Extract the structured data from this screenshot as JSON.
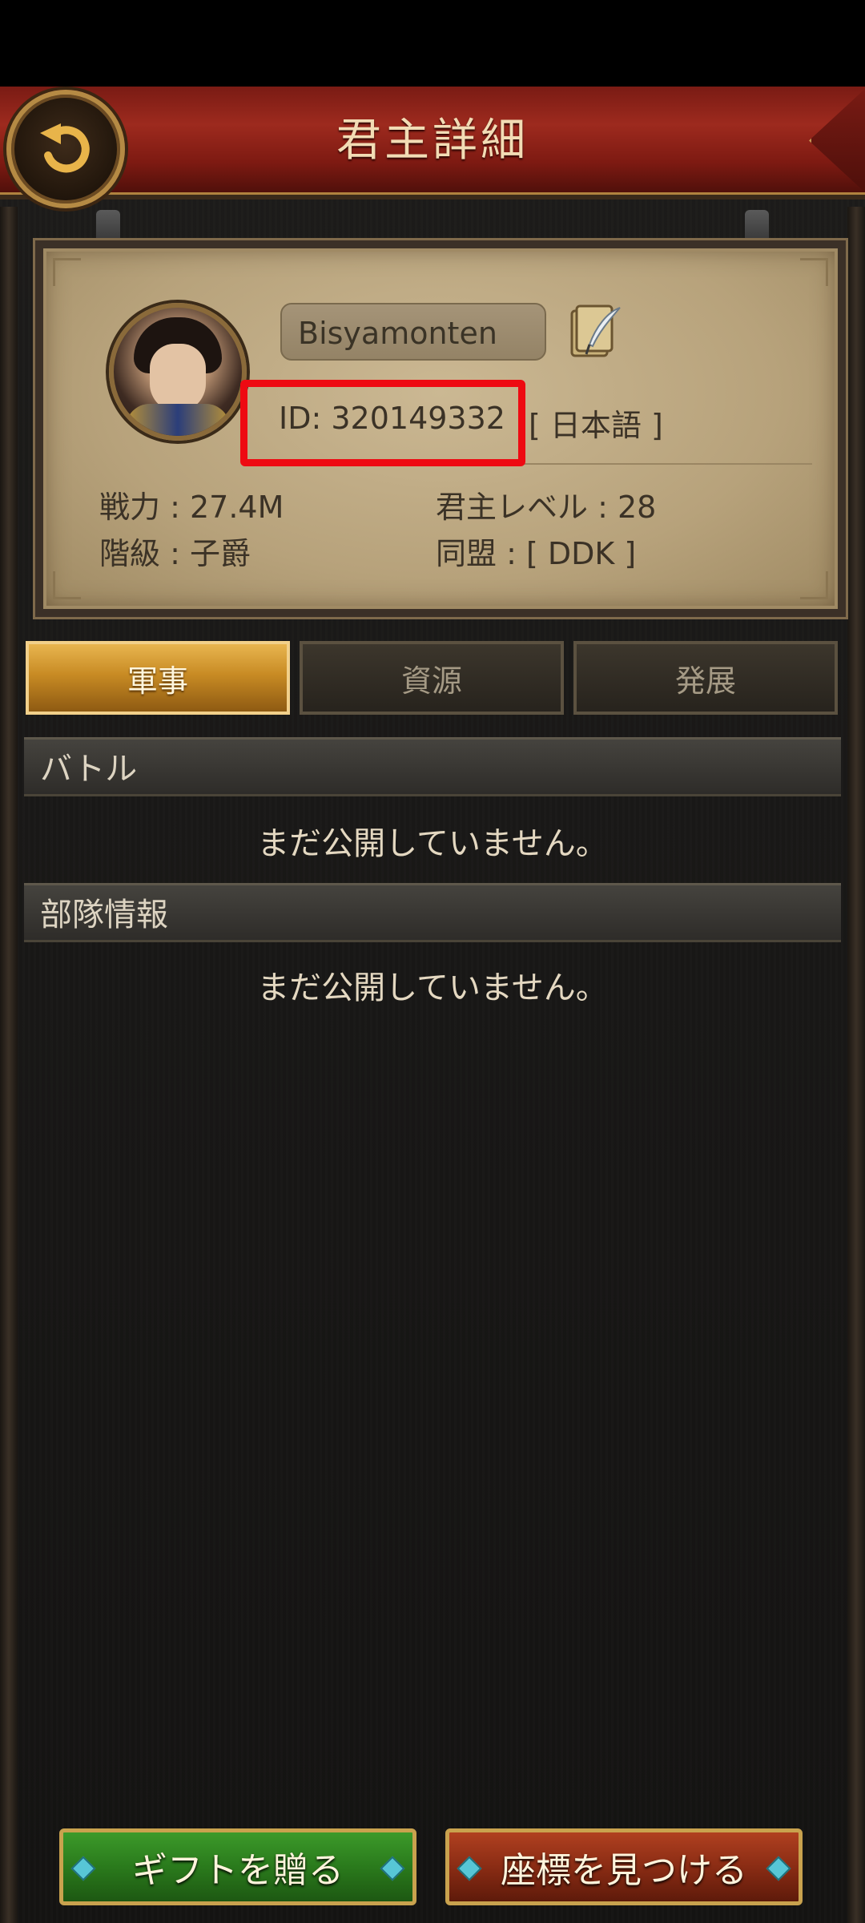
{
  "header": {
    "title": "君主詳細"
  },
  "profile": {
    "name": "Bisyamonten",
    "id_label": "ID:",
    "id_value": "320149332",
    "language": "[ 日本語 ]",
    "power": "戦力 : 27.4M",
    "lord_level": "君主レベル : 28",
    "rank": "階級 : 子爵",
    "alliance": "同盟 :  [ DDK ]"
  },
  "tabs": [
    {
      "label": "軍事",
      "active": true
    },
    {
      "label": "資源",
      "active": false
    },
    {
      "label": "発展",
      "active": false
    }
  ],
  "sections": [
    {
      "title": "バトル",
      "message": "まだ公開していません。"
    },
    {
      "title": "部隊情報",
      "message": "まだ公開していません。"
    }
  ],
  "buttons": {
    "gift": "ギフトを贈る",
    "find_coords": "座標を見つける"
  },
  "colors": {
    "highlight": "#ee0a12",
    "header_red": "#9d2a1e",
    "active_tab_gold": "#c88b24"
  }
}
